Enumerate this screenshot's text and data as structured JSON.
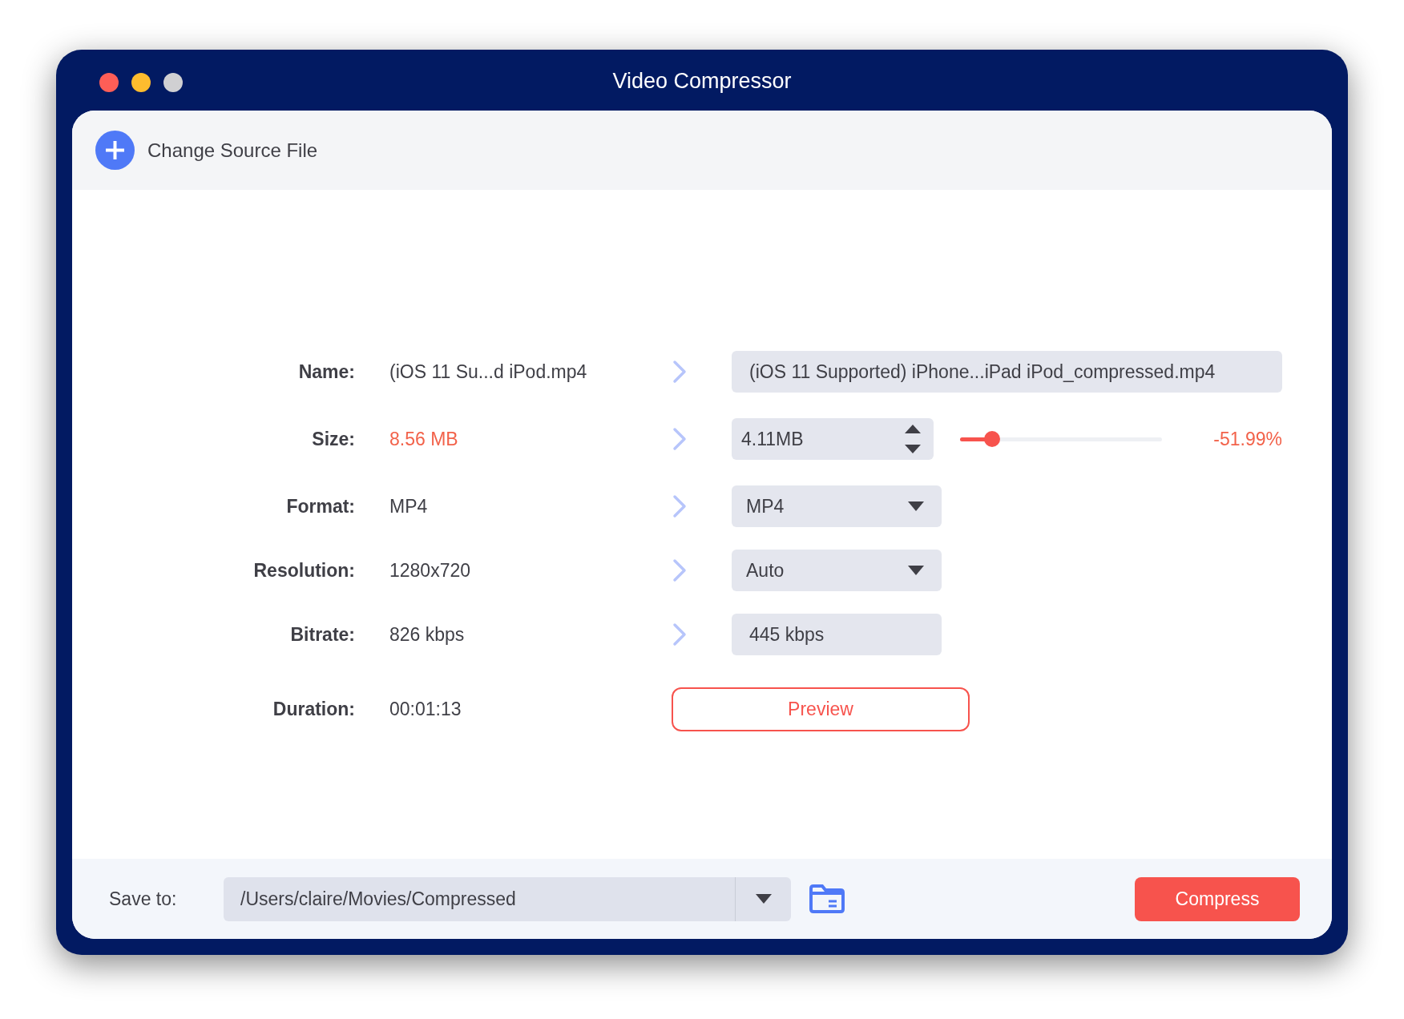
{
  "window": {
    "title": "Video Compressor"
  },
  "toolbar": {
    "change_source": "Change Source File"
  },
  "rows": [
    {
      "kind": "text",
      "label": "Name:",
      "source": "(iOS 11 Su...d iPod.mp4",
      "output": "(iOS 11 Supported) iPhone...iPad iPod_compressed.mp4"
    },
    {
      "kind": "size",
      "label": "Size:",
      "source": "8.56 MB",
      "output": "4.11MB",
      "level": 0.16,
      "reading": "-51.99%"
    },
    {
      "kind": "dropdown",
      "label": "Format:",
      "source": "MP4",
      "output": "MP4"
    },
    {
      "kind": "dropdown",
      "label": "Resolution:",
      "source": "1280x720",
      "output": "Auto"
    },
    {
      "kind": "readonly",
      "label": "Bitrate:",
      "source": "826 kbps",
      "output": "445 kbps"
    },
    {
      "kind": "preview",
      "label": "Duration:",
      "source": "00:01:13",
      "button": "Preview"
    }
  ],
  "footer": {
    "save_label": "Save to:",
    "path": "/Users/claire/Movies/Compressed",
    "compress": "Compress"
  }
}
